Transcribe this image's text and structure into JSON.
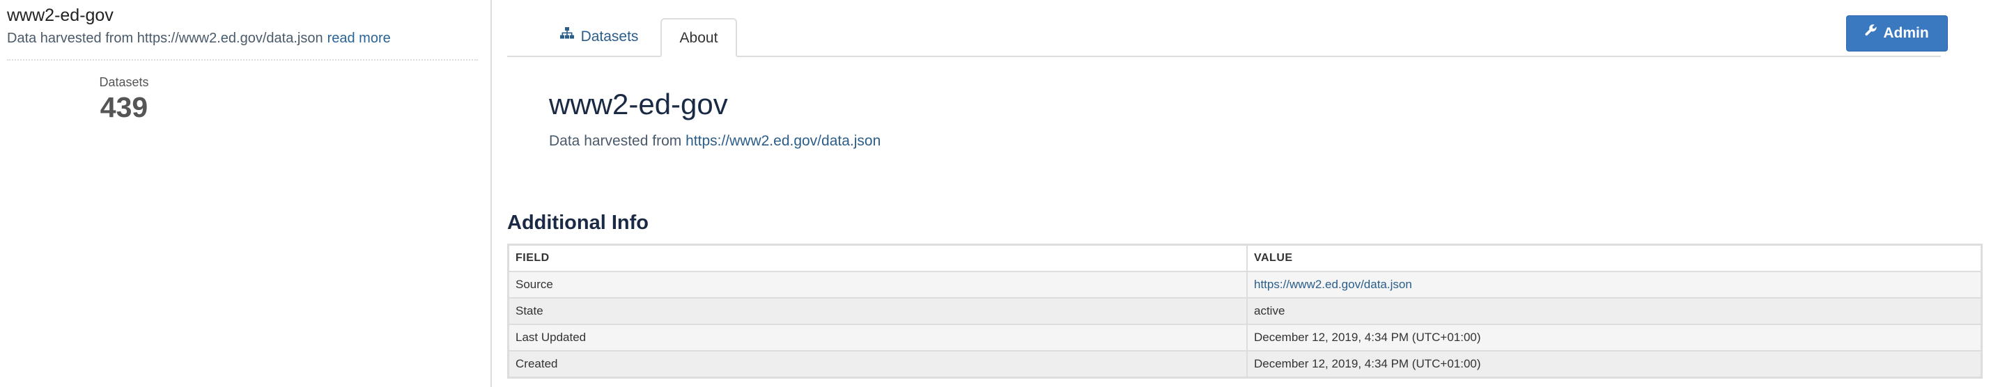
{
  "sidebar": {
    "title": "www2-ed-gov",
    "description": "Data harvested from https://www2.ed.gov/data.json",
    "read_more": "read more",
    "stats": {
      "datasets_label": "Datasets",
      "datasets_count": "439"
    }
  },
  "tabs": [
    {
      "label": "Datasets",
      "icon": "sitemap-icon",
      "active": false
    },
    {
      "label": "About",
      "active": true
    }
  ],
  "admin_button": {
    "label": "Admin",
    "icon": "wrench-icon"
  },
  "about": {
    "title": "www2-ed-gov",
    "description_prefix": "Data harvested from ",
    "description_link": "https://www2.ed.gov/data.json"
  },
  "additional_info": {
    "heading": "Additional Info",
    "columns": [
      "FIELD",
      "VALUE"
    ],
    "rows": [
      {
        "field": "Source",
        "value": "https://www2.ed.gov/data.json",
        "is_link": true
      },
      {
        "field": "State",
        "value": "active"
      },
      {
        "field": "Last Updated",
        "value": "December 12, 2019, 4:34 PM (UTC+01:00)"
      },
      {
        "field": "Created",
        "value": "December 12, 2019, 4:34 PM (UTC+01:00)"
      }
    ]
  },
  "colors": {
    "accent": "#3a78bf",
    "link": "#2a5d8a",
    "heading": "#1a2a44"
  }
}
